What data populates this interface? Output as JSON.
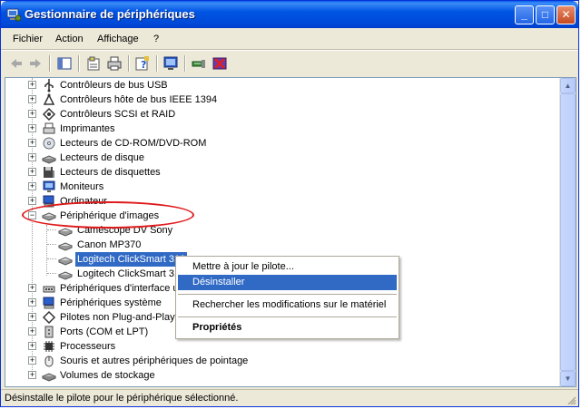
{
  "window": {
    "title": "Gestionnaire de périphériques",
    "controls": {
      "minimize": "_",
      "maximize": "□",
      "close": "✕"
    }
  },
  "menu": [
    "Fichier",
    "Action",
    "Affichage",
    "?"
  ],
  "toolbar": {
    "buttons": [
      "back-icon",
      "forward-icon",
      "console-tree-icon",
      "properties-icon",
      "print-icon",
      "help-icon",
      "scan-hardware-icon",
      "update-driver-icon",
      "uninstall-icon"
    ]
  },
  "tree": {
    "categories_top": [
      "Contrôleurs de bus USB",
      "Contrôleurs hôte de bus IEEE 1394",
      "Contrôleurs SCSI et RAID",
      "Imprimantes",
      "Lecteurs de CD-ROM/DVD-ROM",
      "Lecteurs de disque",
      "Lecteurs de disquettes",
      "Moniteurs",
      "Ordinateur"
    ],
    "expanded_category": "Périphérique d'images",
    "devices": [
      "Caméscope DV Sony",
      "Canon MP370",
      "Logitech ClickSmart 310",
      "Logitech ClickSmart 310"
    ],
    "categories_bottom": [
      "Périphériques d'interface utilisateur",
      "Périphériques système",
      "Pilotes non Plug-and-Play",
      "Ports (COM et LPT)",
      "Processeurs",
      "Souris et autres périphériques de pointage",
      "Volumes de stockage"
    ]
  },
  "context_menu": {
    "update_driver": "Mettre à jour le pilote...",
    "uninstall": "Désinstaller",
    "scan": "Rechercher les modifications sur le matériel",
    "properties": "Propriétés"
  },
  "status": "Désinstalle le pilote pour le périphérique sélectionné.",
  "colors": {
    "accent": "#316ac5",
    "annotation": "#e0191b",
    "titlebar": "#0054e3"
  }
}
